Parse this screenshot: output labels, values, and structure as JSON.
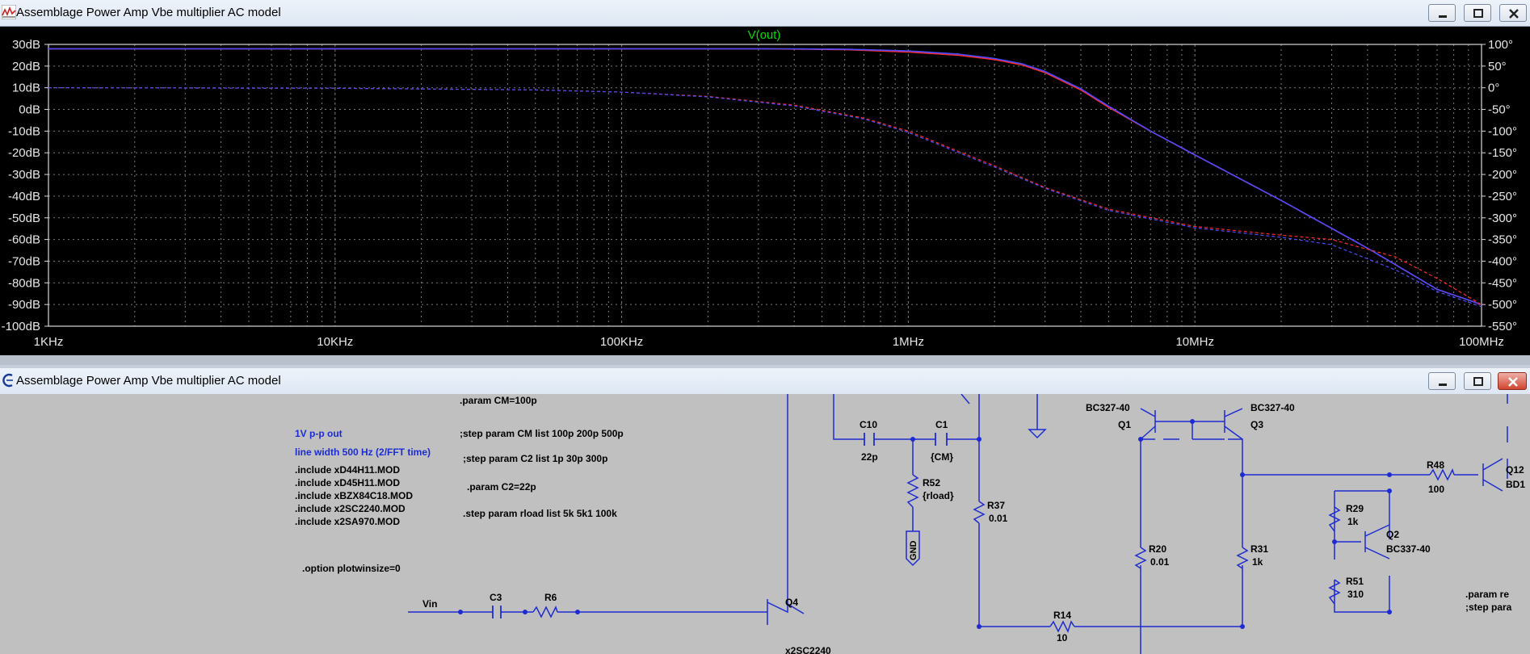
{
  "plot_window": {
    "title": "Assemblage Power Amp Vbe multiplier AC model",
    "trace_label": "V(out)"
  },
  "schematic_window": {
    "title": "Assemblage Power Amp Vbe multiplier AC model"
  },
  "colors": {
    "plot_bg": "#000000",
    "trace_red": "#ff2a2a",
    "trace_blue": "#4b4bff",
    "trace_label": "#00e000",
    "schematic_blue": "#1d2bd3",
    "schematic_bg": "#c0c0c0"
  },
  "chart_data": {
    "type": "line",
    "title": "V(out)",
    "x_scale": "log",
    "xlim": [
      1000,
      100000000
    ],
    "x_ticks": [
      "1KHz",
      "10KHz",
      "100KHz",
      "1MHz",
      "10MHz",
      "100MHz"
    ],
    "y_left_ticks": [
      "30dB",
      "20dB",
      "10dB",
      "0dB",
      "-10dB",
      "-20dB",
      "-30dB",
      "-40dB",
      "-50dB",
      "-60dB",
      "-70dB",
      "-80dB",
      "-90dB",
      "-100dB"
    ],
    "y_right_ticks": [
      "100°",
      "50°",
      "0°",
      "-50°",
      "-100°",
      "-150°",
      "-200°",
      "-250°",
      "-300°",
      "-350°",
      "-400°",
      "-450°",
      "-500°",
      "-550°"
    ],
    "ylim_left": [
      -100,
      30
    ],
    "ylim_right": [
      -550,
      100
    ],
    "grid": true,
    "series": [
      {
        "kind": "magnitude",
        "color": "#ff2a2a",
        "axis": "left",
        "x": [
          1000,
          100000,
          300000,
          600000,
          1000000,
          1500000,
          2000000,
          2500000,
          3000000,
          4000000,
          5000000,
          7000000,
          10000000,
          20000000,
          40000000,
          70000000,
          100000000
        ],
        "y": [
          28,
          28,
          28,
          27.6,
          26.5,
          25,
          23,
          20.5,
          17,
          9,
          1,
          -10,
          -21,
          -42,
          -64,
          -83,
          -90
        ]
      },
      {
        "kind": "magnitude",
        "color": "#4b4bff",
        "axis": "left",
        "x": [
          1000,
          100000,
          300000,
          600000,
          1000000,
          1500000,
          2000000,
          2500000,
          3000000,
          4000000,
          5000000,
          7000000,
          10000000,
          20000000,
          40000000,
          70000000,
          100000000
        ],
        "y": [
          28,
          28,
          28,
          27.8,
          27,
          25.5,
          23.5,
          21,
          17.5,
          9.5,
          1.5,
          -10,
          -21,
          -42,
          -64,
          -83,
          -90
        ]
      },
      {
        "kind": "phase",
        "color": "#ff2a2a",
        "axis": "right",
        "x": [
          1000,
          10000,
          50000,
          100000,
          200000,
          400000,
          700000,
          1000000,
          2000000,
          3000000,
          5000000,
          10000000,
          20000000,
          30000000,
          50000000,
          70000000,
          100000000
        ],
        "y": [
          0,
          -1,
          -5,
          -10,
          -20,
          -40,
          -70,
          -100,
          -180,
          -230,
          -280,
          -320,
          -340,
          -350,
          -390,
          -440,
          -500
        ]
      },
      {
        "kind": "phase",
        "color": "#4b4bff",
        "axis": "right",
        "x": [
          1000,
          10000,
          50000,
          100000,
          200000,
          400000,
          700000,
          1000000,
          2000000,
          3000000,
          5000000,
          10000000,
          20000000,
          30000000,
          50000000,
          70000000,
          100000000
        ],
        "y": [
          0,
          -1,
          -5,
          -10,
          -21,
          -42,
          -72,
          -103,
          -183,
          -232,
          -283,
          -323,
          -345,
          -362,
          -420,
          -470,
          -505
        ]
      }
    ]
  },
  "schematic": {
    "notes": {
      "param_cm": ".param CM=100p",
      "step_cm": ";step param CM list  100p 200p 500p",
      "step_c2": ";step param C2 list 1p 30p 300p",
      "param_c2": ".param C2=22p",
      "step_rload": ".step param rload list 5k 5k1 100k",
      "vpp": "1V p-p out",
      "linewidth": "line width 500 Hz (2/FFT time)",
      "include1": ".include xD44H11.MOD",
      "include2": ".include xD45H11.MOD",
      "include3": ".include xBZX84C18.MOD",
      "include4": ".include x2SC2240.MOD",
      "include5": ".include x2SA970.MOD",
      "option": ".option plotwinsize=0",
      "right1": ".param re",
      "right2": ";step para"
    },
    "components": {
      "c10_name": "C10",
      "c10_val": "22p",
      "c1_name": "C1",
      "c1_val": "{CM}",
      "r52_name": "R52",
      "r52_val": "{rload}",
      "gnd": "GND",
      "r37_name": "R37",
      "r37_val": "0.01",
      "q1_model": "BC327-40",
      "q1_name": "Q1",
      "q3_model": "BC327-40",
      "q3_name": "Q3",
      "r20_name": "R20",
      "r20_val": "0.01",
      "r31_name": "R31",
      "r31_val": "1k",
      "r48_name": "R48",
      "r48_val": "100",
      "q12_name": "Q12",
      "q12_model": "BD1",
      "r29_name": "R29",
      "r29_val": "1k",
      "q2_name": "Q2",
      "q2_model": "BC337-40",
      "r51_name": "R51",
      "r51_val": "310",
      "r14_name": "R14",
      "r14_val": "10",
      "vin": "Vin",
      "c3_name": "C3",
      "r6_name": "R6",
      "q4_name": "Q4",
      "q4_model": "x2SC2240"
    }
  }
}
